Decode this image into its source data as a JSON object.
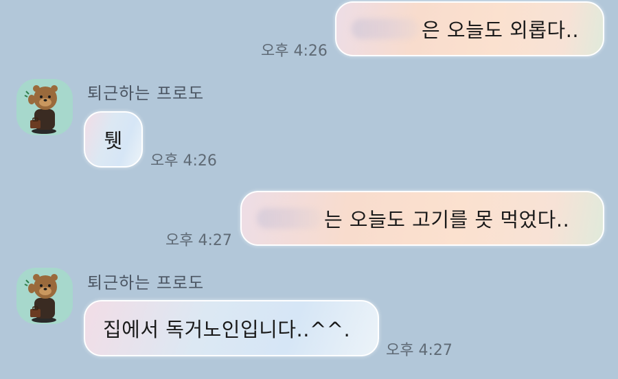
{
  "colors": {
    "background": "#b2c7d9",
    "avatar_bg": "#a7d8cc"
  },
  "messages": [
    {
      "direction": "outgoing",
      "text": "은 오늘도 외롭다..",
      "time": "오후 4:26",
      "has_blurred_name": true
    },
    {
      "direction": "incoming",
      "sender": "퇴근하는 프로도",
      "avatar_icon": "frodo-avatar-icon",
      "text": "퉷",
      "time": "오후 4:26"
    },
    {
      "direction": "outgoing",
      "text": "는 오늘도 고기를 못 먹었다..",
      "time": "오후 4:27",
      "has_blurred_name": true
    },
    {
      "direction": "incoming",
      "sender": "퇴근하는 프로도",
      "avatar_icon": "frodo-avatar-icon",
      "text": "집에서 독거노인입니다..^^.",
      "time": "오후 4:27"
    }
  ]
}
